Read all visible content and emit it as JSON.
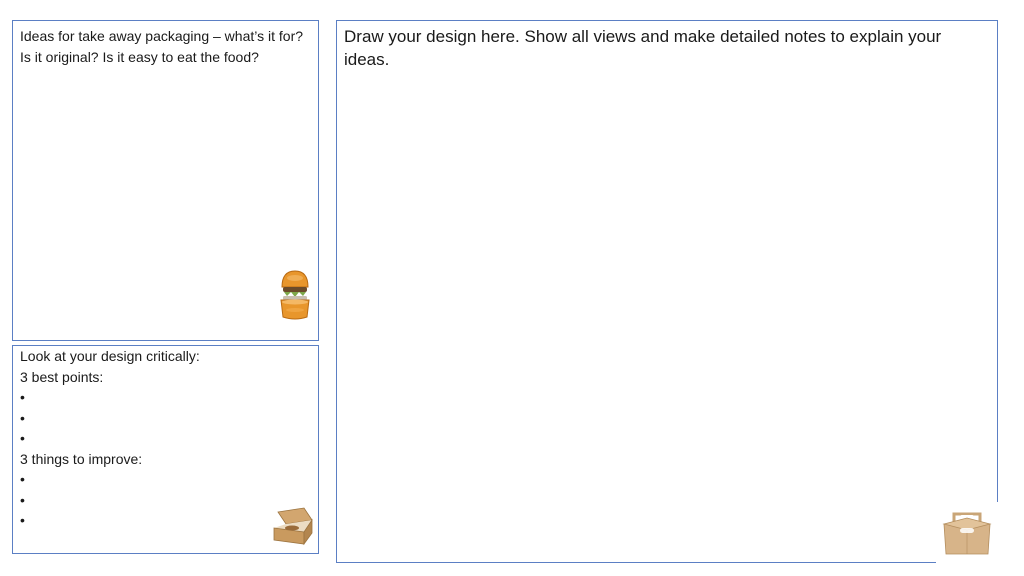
{
  "ideas_panel": {
    "prompt": "Ideas for take away packaging – what’s it for? Is it original? Is it easy to eat the food?"
  },
  "design_panel": {
    "prompt": "Draw your design here. Show all views and make detailed notes to explain your ideas."
  },
  "critical_panel": {
    "heading": "Look at your design critically:",
    "best_label": "3 best points:",
    "improve_label": "3 things to improve:"
  },
  "images": {
    "burger_icon": "burger-packaging-icon",
    "burger_box_icon": "clamshell-box-icon",
    "carry_box_icon": "carry-box-icon"
  },
  "colors": {
    "border": "#5b7fc4"
  }
}
